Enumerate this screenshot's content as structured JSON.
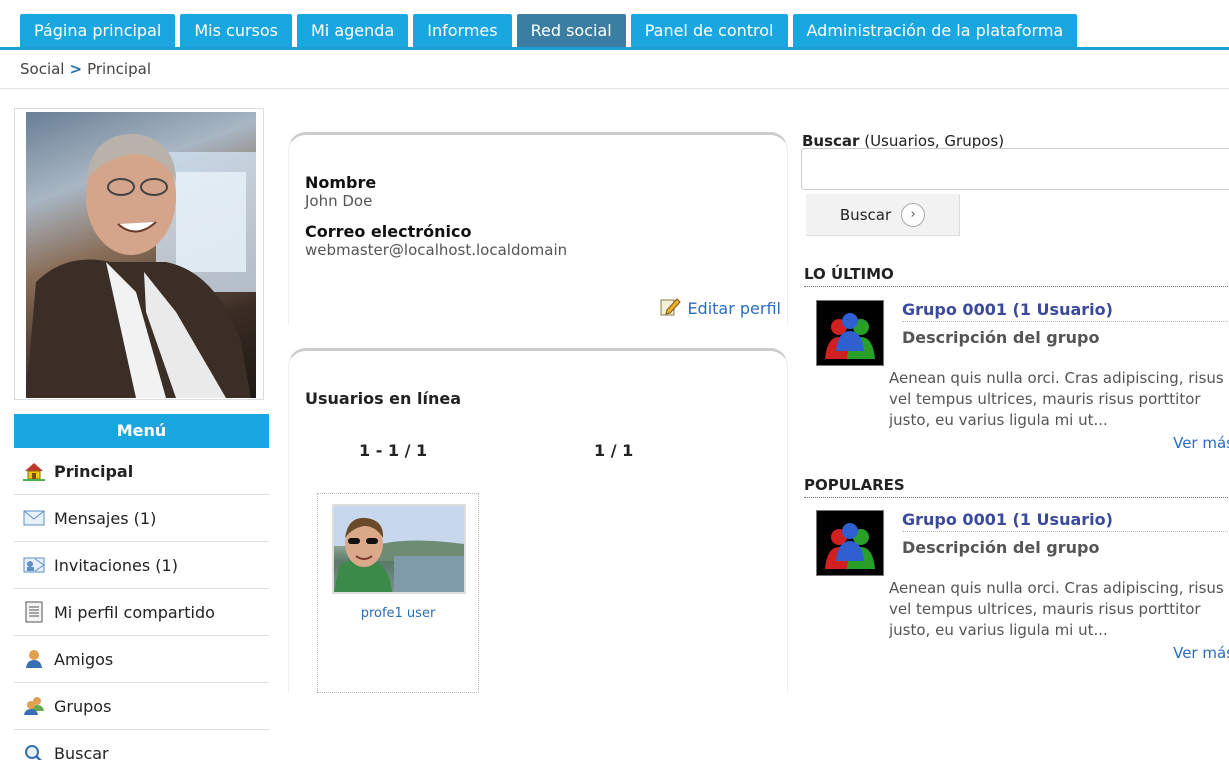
{
  "nav": {
    "tabs": [
      {
        "label": "Página principal",
        "active": false
      },
      {
        "label": "Mis cursos",
        "active": false
      },
      {
        "label": "Mi agenda",
        "active": false
      },
      {
        "label": "Informes",
        "active": false
      },
      {
        "label": "Red social",
        "active": true
      },
      {
        "label": "Panel de control",
        "active": false
      },
      {
        "label": "Administración de la plataforma",
        "active": false
      }
    ]
  },
  "breadcrumb": {
    "root": "Social",
    "separator": ">",
    "current": "Principal"
  },
  "menu": {
    "title": "Menú",
    "items": [
      {
        "label": "Principal",
        "icon": "home-icon"
      },
      {
        "label": "Mensajes (1)",
        "icon": "envelope-icon"
      },
      {
        "label": "Invitaciones (1)",
        "icon": "invitation-icon"
      },
      {
        "label": "Mi perfil compartido",
        "icon": "document-icon"
      },
      {
        "label": "Amigos",
        "icon": "user-icon"
      },
      {
        "label": "Grupos",
        "icon": "group-icon"
      },
      {
        "label": "Buscar",
        "icon": "search-icon"
      }
    ]
  },
  "profile": {
    "name_label": "Nombre",
    "name": "John Doe",
    "email_label": "Correo electrónico",
    "email": "webmaster@localhost.localdomain",
    "edit_label": "Editar perfil"
  },
  "online": {
    "title": "Usuarios en línea",
    "range": "1 - 1 / 1",
    "pages": "1 / 1",
    "users": [
      {
        "name": "profe1 user"
      }
    ]
  },
  "search": {
    "label_bold": "Buscar",
    "label_rest": " (Usuarios, Grupos)",
    "value": "",
    "button": "Buscar"
  },
  "latest": {
    "title": "LO ÚLTIMO",
    "group_name": "Grupo 0001 (1 Usuario)",
    "desc_title": "Descripción del grupo",
    "text": "Aenean quis nulla orci. Cras adipiscing, risus vel tempus ultrices, mauris risus porttitor justo, eu varius ligula mi ut...",
    "more": "Ver más"
  },
  "popular": {
    "title": "POPULARES",
    "group_name": "Grupo 0001 (1 Usuario)",
    "desc_title": "Descripción del grupo",
    "text": "Aenean quis nulla orci. Cras adipiscing, risus vel tempus ultrices, mauris risus porttitor justo, eu varius ligula mi ut...",
    "more": "Ver más"
  },
  "colors": {
    "tab": "#1aa7e0",
    "tab_active": "#3b7ea3",
    "link": "#2a6cbf",
    "group_link": "#3b4a9b"
  }
}
